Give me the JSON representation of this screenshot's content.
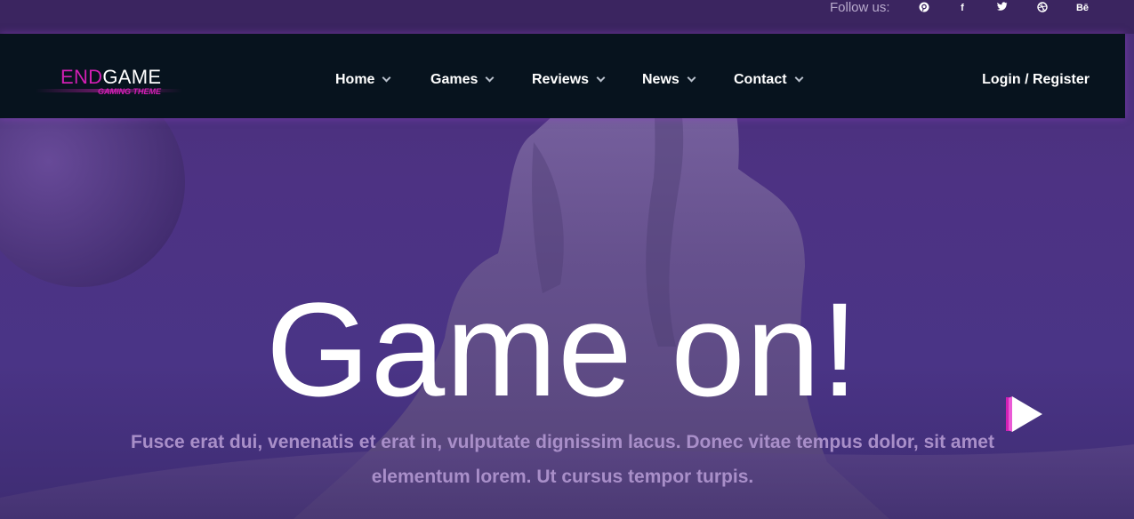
{
  "topbar": {
    "follow_label": "Follow us:",
    "social_icons": [
      "pinterest-icon",
      "facebook-icon",
      "twitter-icon",
      "dribbble-icon",
      "behance-icon"
    ],
    "social_glyphs": [
      "P",
      "f",
      "t",
      "d",
      "Bē"
    ]
  },
  "logo": {
    "name_part1": "END",
    "name_part2": "GAME",
    "tagline": "GAMING THEME"
  },
  "nav": {
    "items": [
      {
        "label": "Home"
      },
      {
        "label": "Games"
      },
      {
        "label": "Reviews"
      },
      {
        "label": "News"
      },
      {
        "label": "Contact"
      }
    ],
    "login": "Login / Register"
  },
  "hero": {
    "title": "Game on!",
    "text": "Fusce erat dui, venenatis et erat in, vulputate dignissim lacus. Donec vitae tempus dolor, sit amet elementum lorem. Ut cursus tempor turpis."
  },
  "colors": {
    "accent": "#d21fb4",
    "navbar": "#07131e",
    "background": "#4a3486"
  }
}
